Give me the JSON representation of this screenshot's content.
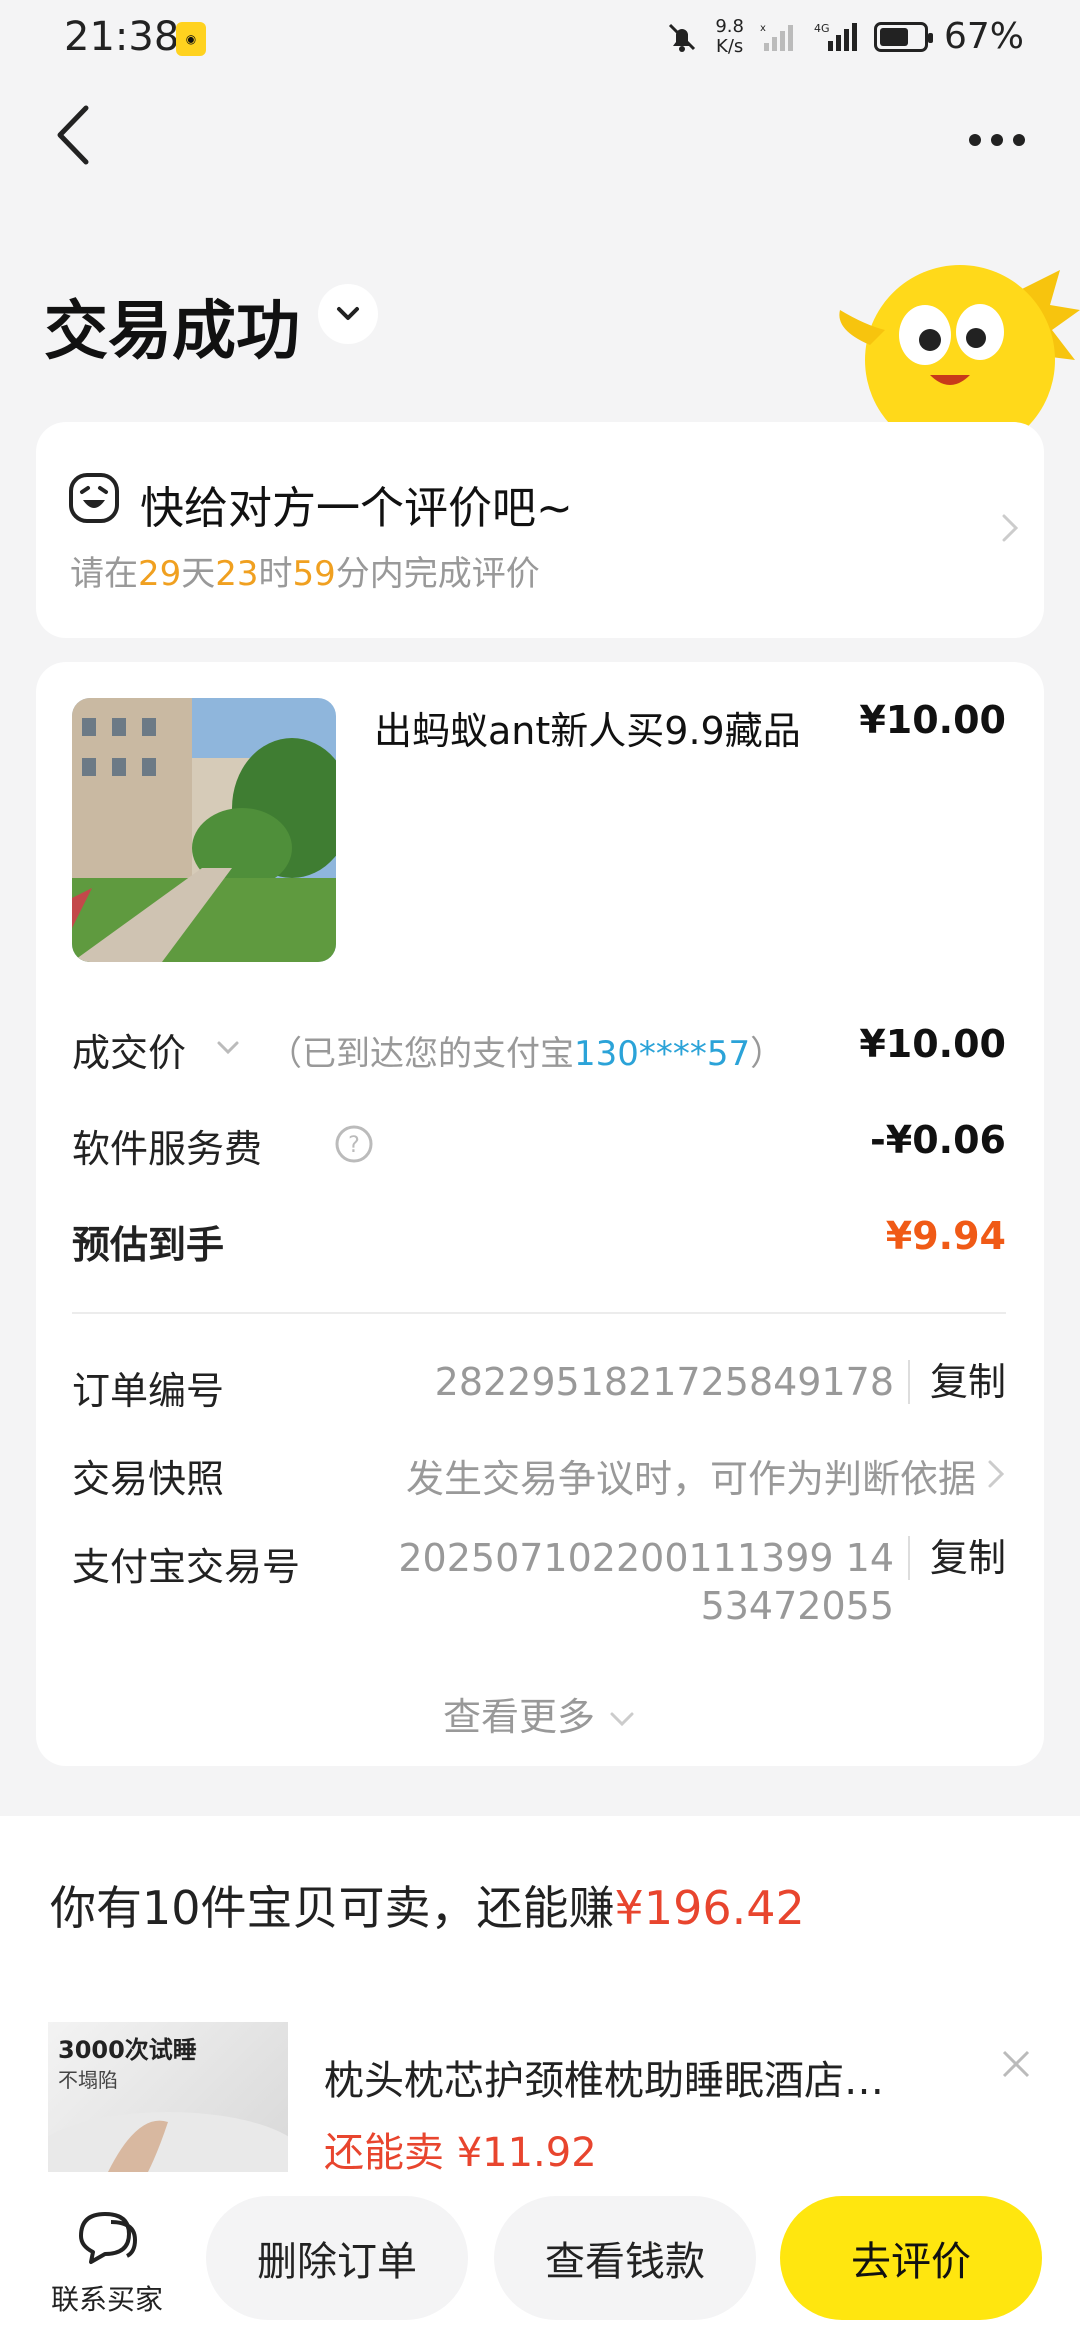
{
  "status_bar": {
    "time": "21:38",
    "speed_top": "9.8",
    "speed_bottom": "K/s",
    "battery": "67%",
    "battery_level": 0.67
  },
  "header": {
    "title": "交易成功"
  },
  "review_card": {
    "title": "快给对方一个评价吧~",
    "sub_prefix": "请在",
    "days": "29",
    "days_unit": "天",
    "hours": "23",
    "hours_unit": "时",
    "minutes": "59",
    "minutes_suffix": "分内完成评价"
  },
  "product": {
    "title": "出蚂蚁ant新人买9.9藏品",
    "price": "¥10.00"
  },
  "price_rows": {
    "deal_label": "成交价",
    "deal_note_prefix": "（已到达您的支付宝",
    "deal_note_account": "130****57",
    "deal_note_suffix": "）",
    "deal_value": "¥10.00",
    "fee_label": "软件服务费",
    "fee_value": "-¥0.06",
    "net_label": "预估到手",
    "net_value": "¥9.94"
  },
  "info_rows": {
    "order_no_label": "订单编号",
    "order_no_value": "2822951821725849178",
    "snapshot_label": "交易快照",
    "snapshot_value": "发生交易争议时，可作为判断依据",
    "alipay_label": "支付宝交易号",
    "alipay_value_line1": "202507102200111399 14",
    "alipay_value_line2": "53472055",
    "copy_label": "复制"
  },
  "see_more": "查看更多",
  "sell": {
    "title_prefix": "你有10件宝贝可卖，还能赚",
    "amount": "¥196.42",
    "rec_tag1": "3000次试睡",
    "rec_tag2": "不塌陷",
    "rec_title": "枕头枕芯护颈椎枕助睡眠酒店…",
    "rec_price": "还能卖 ¥11.92"
  },
  "bottom_bar": {
    "contact": "联系买家",
    "delete": "删除订单",
    "view_money": "查看钱款",
    "review": "去评价"
  },
  "colors": {
    "accent_yellow": "#ffe60f",
    "price_orange": "#f05a16",
    "highlight_orange": "#f0a020",
    "link_blue": "#2ba3d8",
    "sell_red": "#e8452e"
  }
}
